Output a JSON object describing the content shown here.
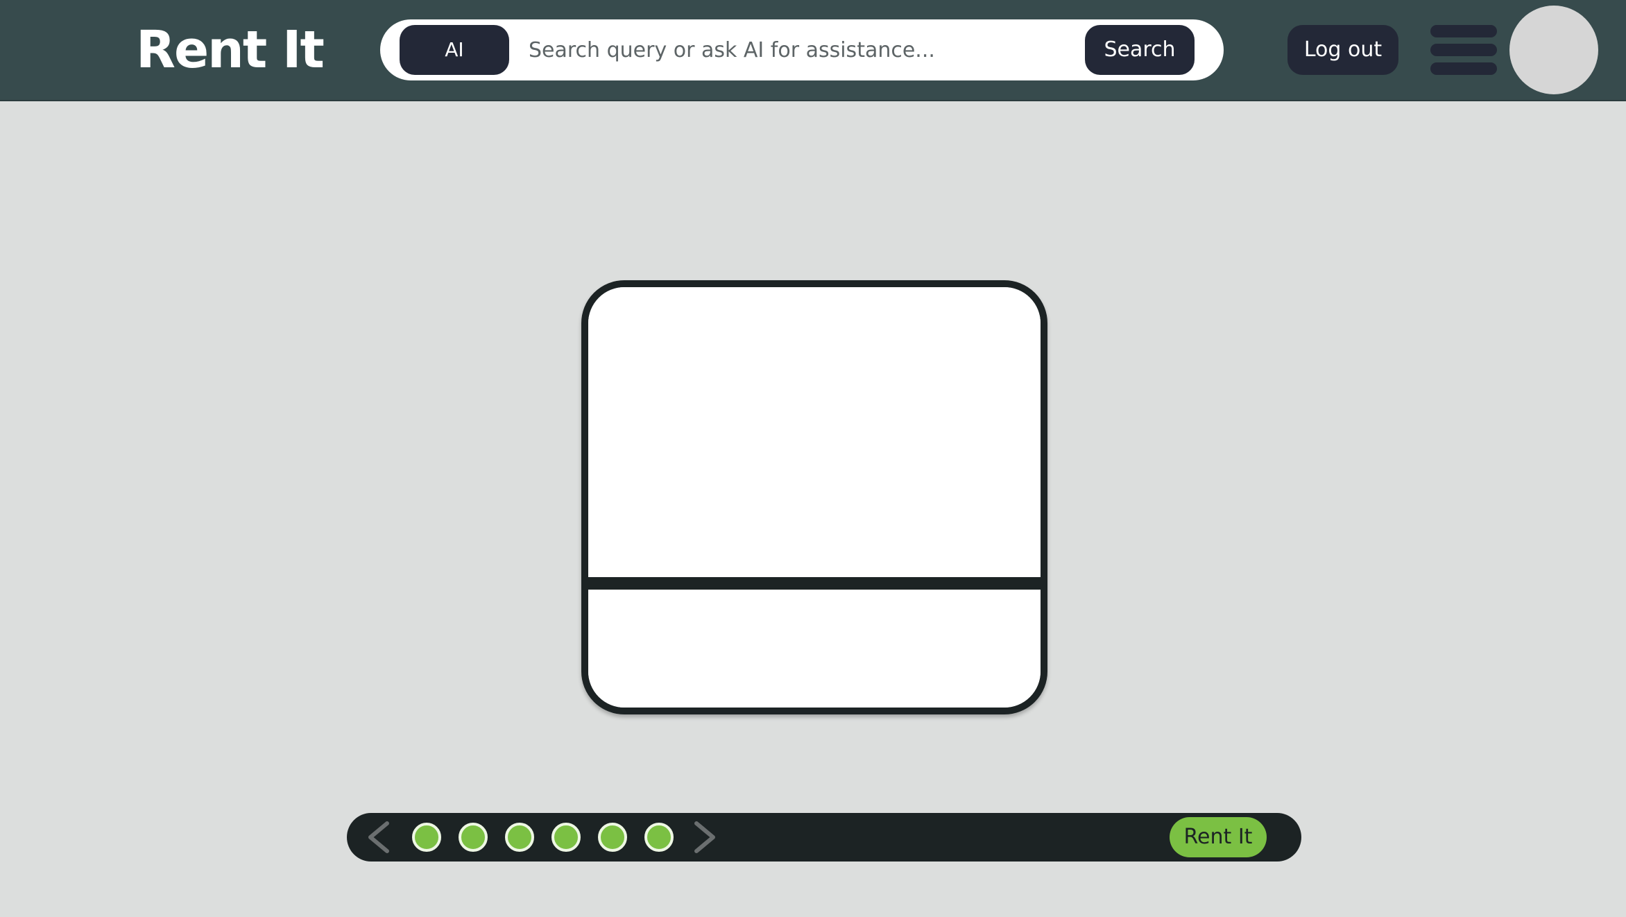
{
  "header": {
    "logo_text": "Rent It",
    "ai_button_label": "AI",
    "search_placeholder": "Search query or ask AI for assistance...",
    "search_button_label": "Search",
    "logout_label": "Log out",
    "menu_icon": "hamburger-menu-icon",
    "avatar": "user-avatar"
  },
  "carousel": {
    "prev_icon": "chevron-left-icon",
    "next_icon": "chevron-right-icon",
    "dot_count": 6,
    "rent_button_label": "Rent It"
  },
  "colors": {
    "header_bg": "#374b4d",
    "page_bg": "#dcdedd",
    "button_dark": "#232837",
    "accent_green": "#7bc043",
    "card_border": "#1c2324"
  }
}
